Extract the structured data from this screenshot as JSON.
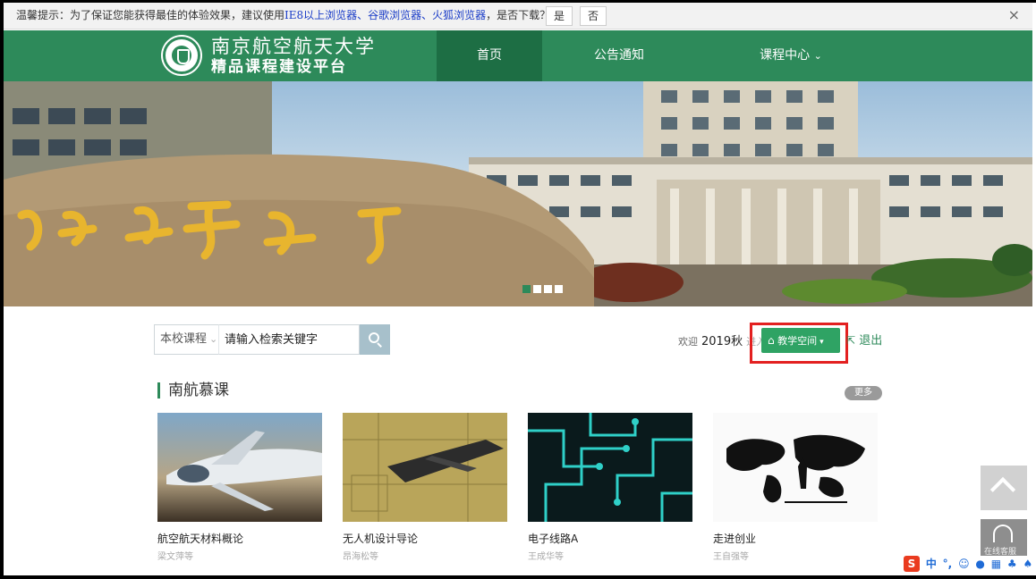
{
  "notice": {
    "prefix": "温馨提示：为了保证您能获得最佳的体验效果，建议使用",
    "browsers": "IE8以上浏览器、谷歌浏览器、火狐浏览器",
    "suffix": "，是否下载？",
    "yes": "是",
    "no": "否",
    "close": "×"
  },
  "header": {
    "title_line1": "南京航空航天大学",
    "title_line2": "精品课程建设平台",
    "nav": {
      "home": "首页",
      "notice": "公告通知",
      "courses": "课程中心"
    }
  },
  "banner": {
    "slides": 4,
    "active_slide": 1
  },
  "search": {
    "scope": "本校课程",
    "placeholder": "请输入检索关键字"
  },
  "user": {
    "welcome": "欢迎",
    "term": "2019秋",
    "enter": "进入",
    "space_button": "教学空间",
    "logout": "退出"
  },
  "section": {
    "title": "南航慕课",
    "more": "更多"
  },
  "courses": [
    {
      "name": "航空航天材料概论",
      "teacher": "梁文萍等"
    },
    {
      "name": "无人机设计导论",
      "teacher": "昂海松等"
    },
    {
      "name": "电子线路A",
      "teacher": "王成华等"
    },
    {
      "name": "走进创业",
      "teacher": "王自强等"
    }
  ],
  "widgets": {
    "service": "在线客服"
  },
  "ime": {
    "logo": "S",
    "mode": "中"
  },
  "colors": {
    "brand": "#2d8a5a",
    "brand_dark": "#1d6e44",
    "button": "#2fa364",
    "highlight": "#e32020"
  }
}
